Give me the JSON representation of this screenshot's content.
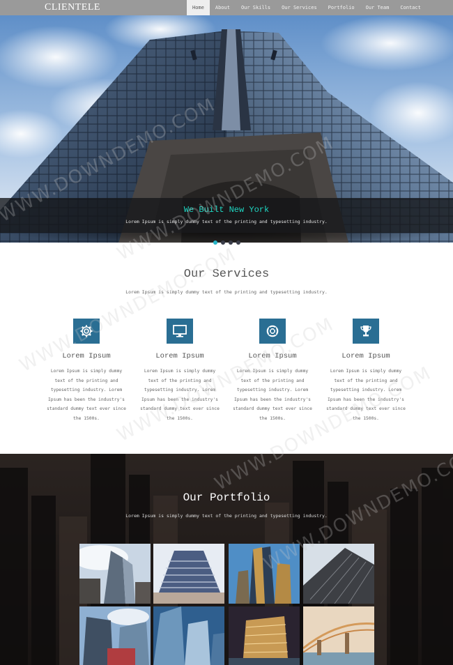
{
  "header": {
    "logo": "CLIENTELE",
    "nav": [
      "Home",
      "About",
      "Our Skills",
      "Our Services",
      "Portfolio",
      "Our Team",
      "Contact"
    ]
  },
  "hero": {
    "title": "We Built New York",
    "subtitle": "Lorem Ipsum is simply dummy text of the printing and typesetting industry.",
    "slides": 4,
    "active_slide": 1
  },
  "services": {
    "title": "Our Services",
    "subtitle": "Lorem Ipsum is simply dummy text of the printing and typesetting industry.",
    "items": [
      {
        "icon": "gear-icon",
        "heading": "Lorem Ipsum",
        "text": "Lorem Ipsum is simply dummy text of the printing and typesetting industry. Lorem Ipsum has been the industry's standard dummy text ever since the 1500s."
      },
      {
        "icon": "monitor-icon",
        "heading": "Lorem Ipsum",
        "text": "Lorem Ipsum is simply dummy text of the printing and typesetting industry. Lorem Ipsum has been the industry's standard dummy text ever since the 1500s."
      },
      {
        "icon": "lifebuoy-icon",
        "heading": "Lorem Ipsum",
        "text": "Lorem Ipsum is simply dummy text of the printing and typesetting industry. Lorem Ipsum has been the industry's standard dummy text ever since the 1500s."
      },
      {
        "icon": "trophy-icon",
        "heading": "Lorem Ipsum",
        "text": "Lorem Ipsum is simply dummy text of the printing and typesetting industry. Lorem Ipsum has been the industry's standard dummy text ever since the 1500s."
      }
    ]
  },
  "portfolio": {
    "title": "Our Portfolio",
    "subtitle": "Lorem Ipsum is simply dummy text of the printing and typesetting industry.",
    "thumbnails": 8
  },
  "watermark": "WWW.DOWNDEMO.COM",
  "colors": {
    "navbar": "#9a9a9a",
    "accent_teal": "#1fd6c2",
    "icon_blue": "#2a6e93",
    "dot_active": "#28b5c7"
  }
}
